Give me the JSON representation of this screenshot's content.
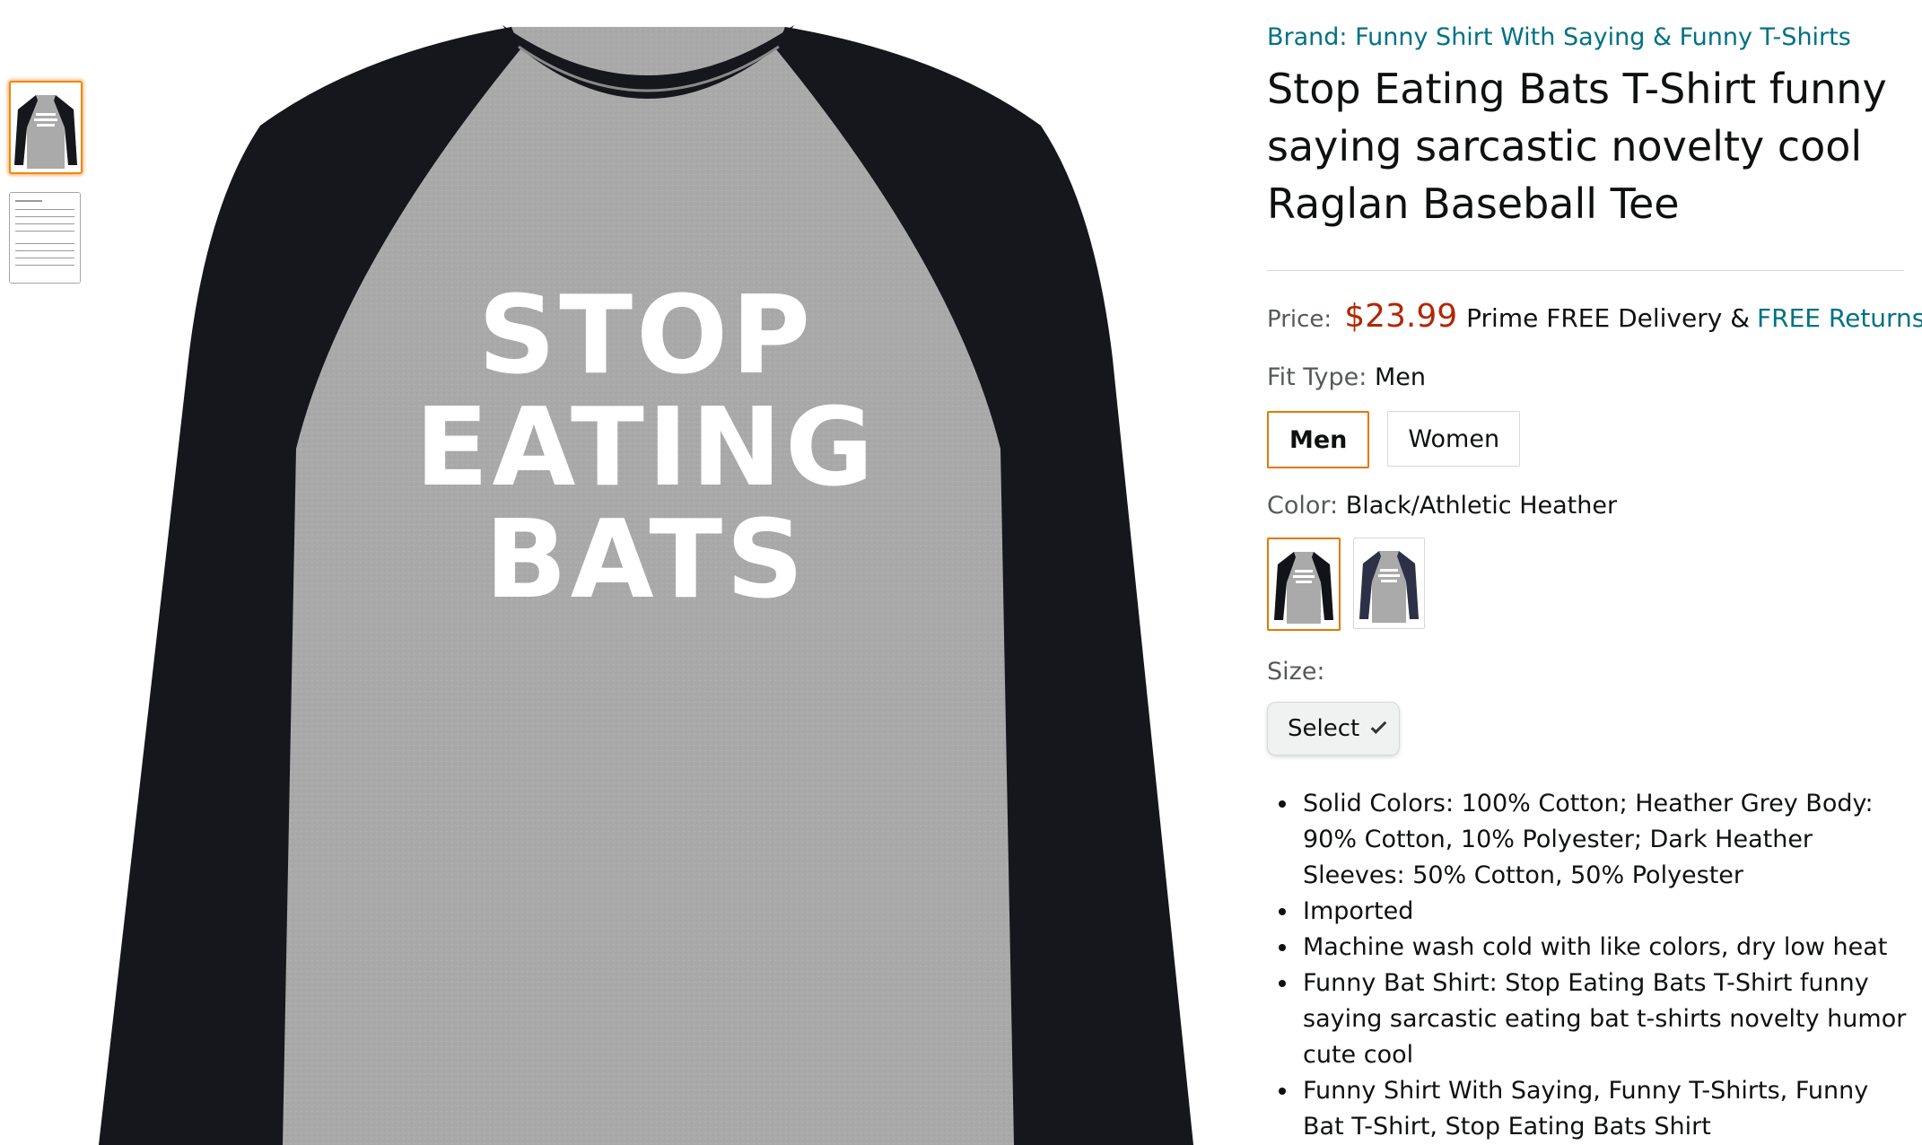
{
  "thumbnails": [
    {
      "name": "thumbnail-shirt",
      "selected": true
    },
    {
      "name": "thumbnail-size-chart",
      "selected": false
    }
  ],
  "main_image": {
    "shirt_lines": [
      "STOP",
      "EATING",
      "BATS"
    ]
  },
  "product": {
    "brand": "Brand: Funny Shirt With Saying & Funny T-Shirts",
    "title": "Stop Eating Bats T-Shirt funny saying sarcastic novelty cool Raglan Baseball Tee",
    "price_label": "Price:",
    "price": "$23.99",
    "prime_text": "Prime FREE Delivery &",
    "free_returns": "FREE Returns",
    "fit_type": {
      "label": "Fit Type:",
      "value": "Men",
      "options": [
        "Men",
        "Women"
      ]
    },
    "color": {
      "label": "Color:",
      "value": "Black/Athletic Heather",
      "swatch_colors": [
        "#111318",
        "#2c3148"
      ]
    },
    "size": {
      "label": "Size:",
      "select_label": "Select"
    },
    "bullets": [
      "Solid Colors: 100% Cotton; Heather Grey Body: 90% Cotton, 10% Polyester; Dark Heather Sleeves: 50% Cotton, 50% Polyester",
      "Imported",
      "Machine wash cold with like colors, dry low heat",
      "Funny Bat Shirt: Stop Eating Bats T-Shirt funny saying sarcastic eating bat t-shirts novelty humor cute cool",
      "Funny Shirt With Saying, Funny T-Shirts, Funny Bat T-Shirt, Stop Eating Bats Shirt"
    ]
  },
  "colors": {
    "link": "#007185",
    "price": "#b12704",
    "selected_border": "#e77600",
    "shirt_body": "#a9a9a9",
    "shirt_sleeves": "#15171c"
  }
}
